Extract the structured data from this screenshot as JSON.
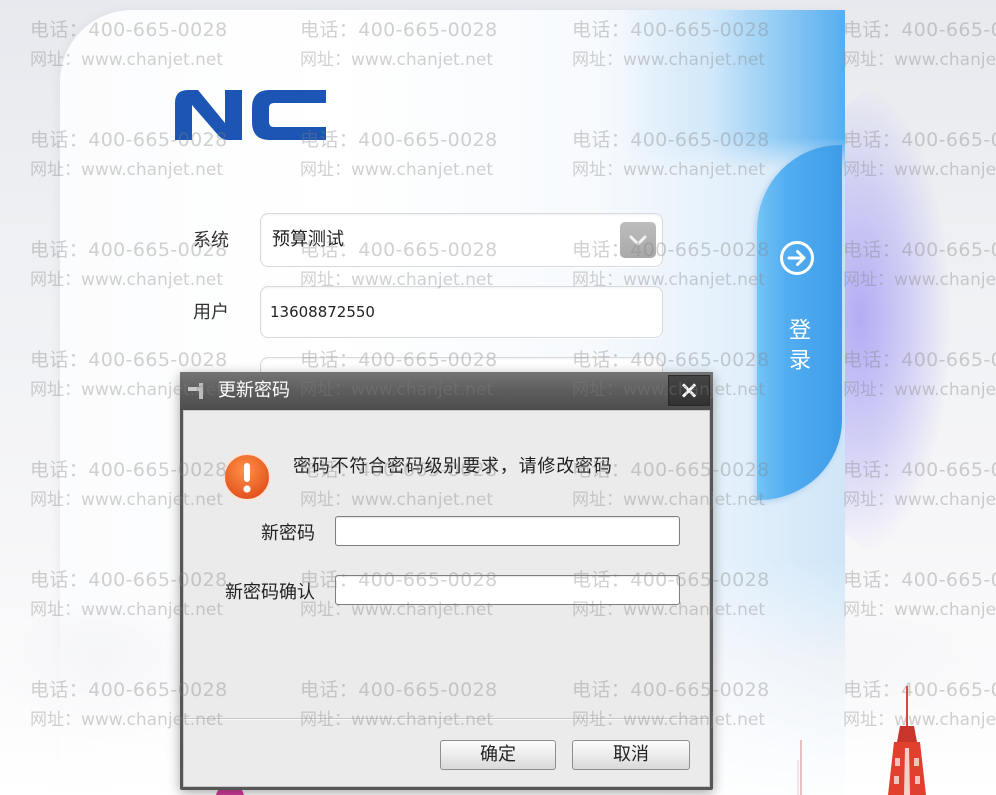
{
  "brand": {
    "logo_text": "NC"
  },
  "login": {
    "system_label": "系统",
    "system_value": "预算测试",
    "user_label": "用户",
    "user_value": "13608872550",
    "login_button_label": "登录"
  },
  "dialog": {
    "title": "更新密码",
    "close_symbol": "×",
    "message": "密码不符合密码级别要求，请修改密码",
    "fields": [
      {
        "label": "新密码"
      },
      {
        "label": "新密码确认"
      }
    ],
    "ok_label": "确定",
    "cancel_label": "取消"
  },
  "watermark": {
    "phone": "电话：400-665-0028",
    "website": "网址：www.chanjet.net"
  },
  "icons": {
    "dropdown": "chevron-down-icon",
    "login": "arrow-right-circle-icon",
    "dialog_title": "pin-icon",
    "warning": "warning-icon",
    "close": "close-icon"
  },
  "colors": {
    "brand_blue": "#1c55b3",
    "login_blue": "#4aa6ee",
    "titlebar_gray": "#5b5b5b",
    "warning_orange": "#f06a21"
  }
}
